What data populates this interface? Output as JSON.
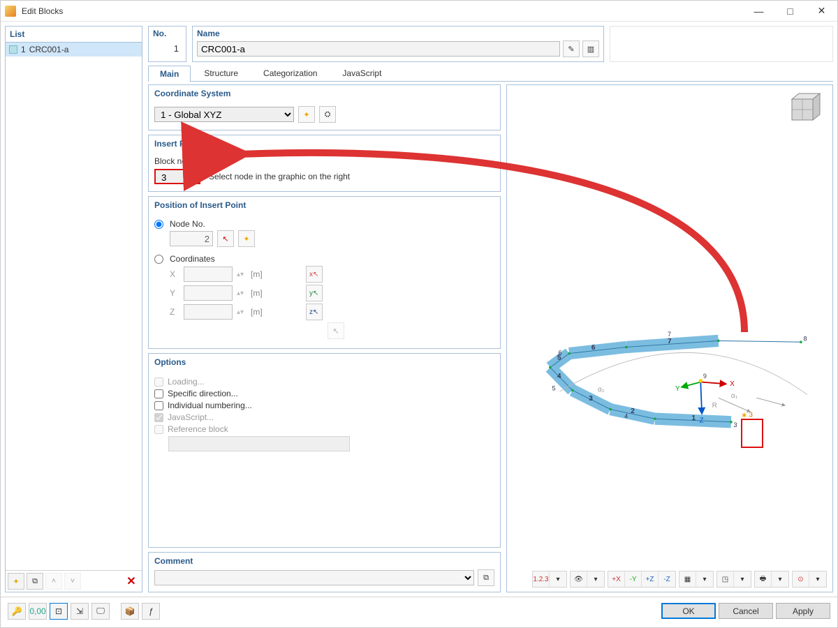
{
  "window": {
    "title": "Edit Blocks"
  },
  "list": {
    "header": "List",
    "items": [
      {
        "num": "1",
        "name": "CRC001-a",
        "selected": true
      }
    ]
  },
  "record": {
    "no_label": "No.",
    "no_value": "1",
    "name_label": "Name",
    "name_value": "CRC001-a"
  },
  "tabs": [
    "Main",
    "Structure",
    "Categorization",
    "JavaScript"
  ],
  "active_tab": "Main",
  "coord_system": {
    "title": "Coordinate System",
    "value": "1 - Global XYZ"
  },
  "insert_point": {
    "title": "Insert Point",
    "label": "Block node No.",
    "value": "3",
    "hint": "Select node in the graphic on the right"
  },
  "position": {
    "title": "Position of Insert Point",
    "node_label": "Node No.",
    "node_value": "2",
    "coord_label": "Coordinates",
    "axes": [
      "X",
      "Y",
      "Z"
    ],
    "unit": "[m]"
  },
  "options": {
    "title": "Options",
    "items": [
      {
        "label": "Loading...",
        "checked": false,
        "disabled": true
      },
      {
        "label": "Specific direction...",
        "checked": false,
        "disabled": false
      },
      {
        "label": "Individual numbering...",
        "checked": false,
        "disabled": false
      },
      {
        "label": "JavaScript...",
        "checked": true,
        "disabled": true
      },
      {
        "label": "Reference block",
        "checked": false,
        "disabled": true
      }
    ]
  },
  "comment": {
    "title": "Comment"
  },
  "viewer": {
    "members": [
      "1",
      "2",
      "3",
      "4",
      "5",
      "6",
      "7"
    ],
    "nodes": [
      "3",
      "4",
      "5",
      "6",
      "7",
      "8",
      "9"
    ],
    "highlight_node": "3",
    "labels": {
      "r": "R",
      "a1": "α₁",
      "a2": "α₂"
    }
  },
  "footer": {
    "ok": "OK",
    "cancel": "Cancel",
    "apply": "Apply"
  }
}
